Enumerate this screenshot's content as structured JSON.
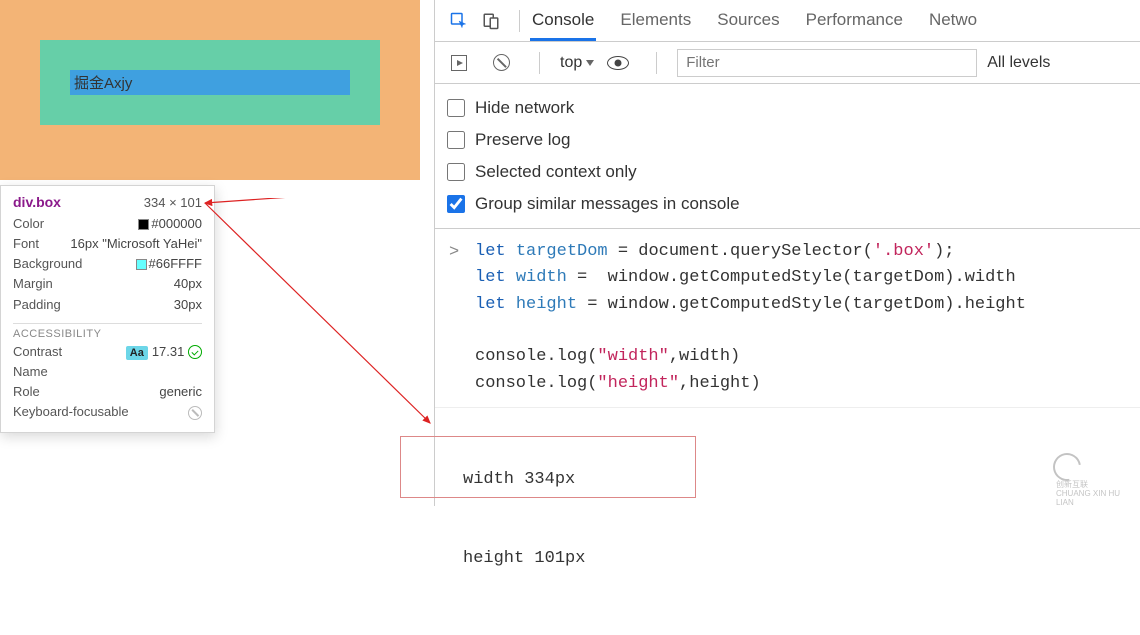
{
  "rendered": {
    "box_text": "掘金Axjy"
  },
  "tooltip": {
    "selector": "div.box",
    "dims": "334 × 101",
    "rows": {
      "color_label": "Color",
      "color_value": "#000000",
      "color_swatch": "#000000",
      "font_label": "Font",
      "font_value": "16px \"Microsoft YaHei\"",
      "bg_label": "Background",
      "bg_value": "#66FFFF",
      "bg_swatch": "#66FFFF",
      "margin_label": "Margin",
      "margin_value": "40px",
      "padding_label": "Padding",
      "padding_value": "30px"
    },
    "a11y_title": "ACCESSIBILITY",
    "contrast_label": "Contrast",
    "contrast_chip": "Aa",
    "contrast_value": "17.31",
    "name_label": "Name",
    "name_value": "",
    "role_label": "Role",
    "role_value": "generic",
    "focusable_label": "Keyboard-focusable"
  },
  "devtools": {
    "tabs": [
      "Console",
      "Elements",
      "Sources",
      "Performance",
      "Netwo"
    ],
    "active_tab": 0,
    "toolbar2": {
      "context": "top",
      "filter_placeholder": "Filter",
      "levels": "All levels"
    },
    "settings": {
      "hide_network": "Hide network",
      "preserve_log": "Preserve log",
      "selected_context": "Selected context only",
      "group_similar": "Group similar messages in console"
    },
    "code": {
      "line1_kw": "let ",
      "line1_var": "targetDom",
      "line1_rest_a": " = document.querySelector(",
      "line1_str": "'.box'",
      "line1_rest_b": ");",
      "line2_kw": "let ",
      "line2_var": "width",
      "line2_rest": " =  window.getComputedStyle(targetDom).width",
      "line3_kw": "let ",
      "line3_var": "height",
      "line3_rest": " = window.getComputedStyle(targetDom).height",
      "line5": "console.log(",
      "line5_str": "\"width\"",
      "line5_rest": ",width)",
      "line6": "console.log(",
      "line6_str": "\"height\"",
      "line6_rest": ",height)"
    },
    "output": {
      "l1": "width 334px",
      "l2": "height 101px"
    }
  },
  "logo": {
    "brand_cn": "创新互联",
    "brand_py": "CHUANG XIN HU LIAN"
  }
}
